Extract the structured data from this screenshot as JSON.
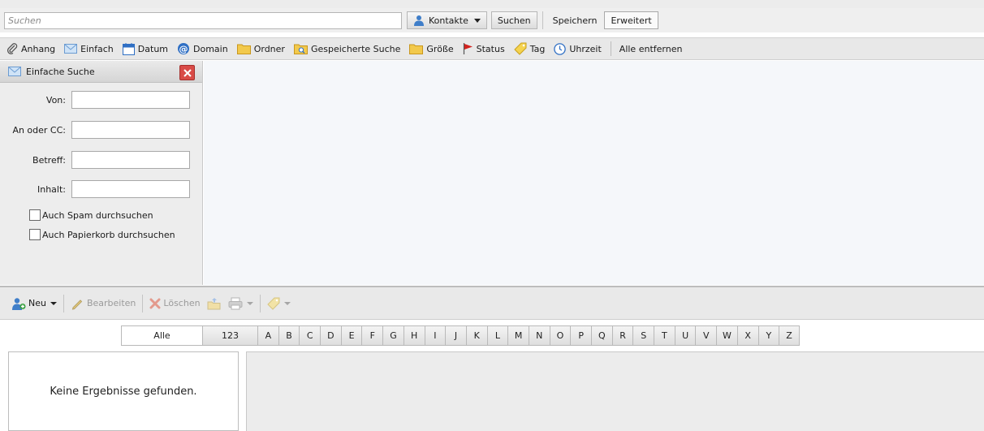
{
  "search": {
    "placeholder": "Suchen",
    "contacts_label": "Kontakte",
    "search_button": "Suchen",
    "save_button": "Speichern",
    "advanced_button": "Erweitert"
  },
  "filters": {
    "items": [
      {
        "label": "Anhang",
        "icon": "paperclip-icon"
      },
      {
        "label": "Einfach",
        "icon": "envelope-icon"
      },
      {
        "label": "Datum",
        "icon": "calendar-icon"
      },
      {
        "label": "Domain",
        "icon": "at-sign-icon"
      },
      {
        "label": "Ordner",
        "icon": "folder-icon"
      },
      {
        "label": "Gespeicherte Suche",
        "icon": "saved-search-folder-icon"
      },
      {
        "label": "Größe",
        "icon": "folder-icon"
      },
      {
        "label": "Status",
        "icon": "flag-icon"
      },
      {
        "label": "Tag",
        "icon": "tag-icon"
      },
      {
        "label": "Uhrzeit",
        "icon": "clock-icon"
      }
    ],
    "remove_all": "Alle entfernen"
  },
  "simple_search": {
    "title": "Einfache Suche",
    "fields": [
      {
        "label": "Von:",
        "value": ""
      },
      {
        "label": "An oder CC:",
        "value": ""
      },
      {
        "label": "Betreff:",
        "value": ""
      },
      {
        "label": "Inhalt:",
        "value": ""
      }
    ],
    "checkboxes": [
      {
        "label": "Auch Spam durchsuchen",
        "checked": false
      },
      {
        "label": "Auch Papierkorb durchsuchen",
        "checked": false
      }
    ]
  },
  "toolbar": {
    "new_label": "Neu",
    "edit_label": "Bearbeiten",
    "delete_label": "Löschen"
  },
  "alphabet": {
    "active": "Alle",
    "letters": [
      "Alle",
      "123",
      "A",
      "B",
      "C",
      "D",
      "E",
      "F",
      "G",
      "H",
      "I",
      "J",
      "K",
      "L",
      "M",
      "N",
      "O",
      "P",
      "Q",
      "R",
      "S",
      "T",
      "U",
      "V",
      "W",
      "X",
      "Y",
      "Z"
    ]
  },
  "results": {
    "empty_message": "Keine Ergebnisse gefunden."
  },
  "colors": {
    "accent_blue": "#2f6fc4",
    "close_red": "#d94b47",
    "flag_red": "#d2231e",
    "folder_yellow": "#f2c94c"
  }
}
